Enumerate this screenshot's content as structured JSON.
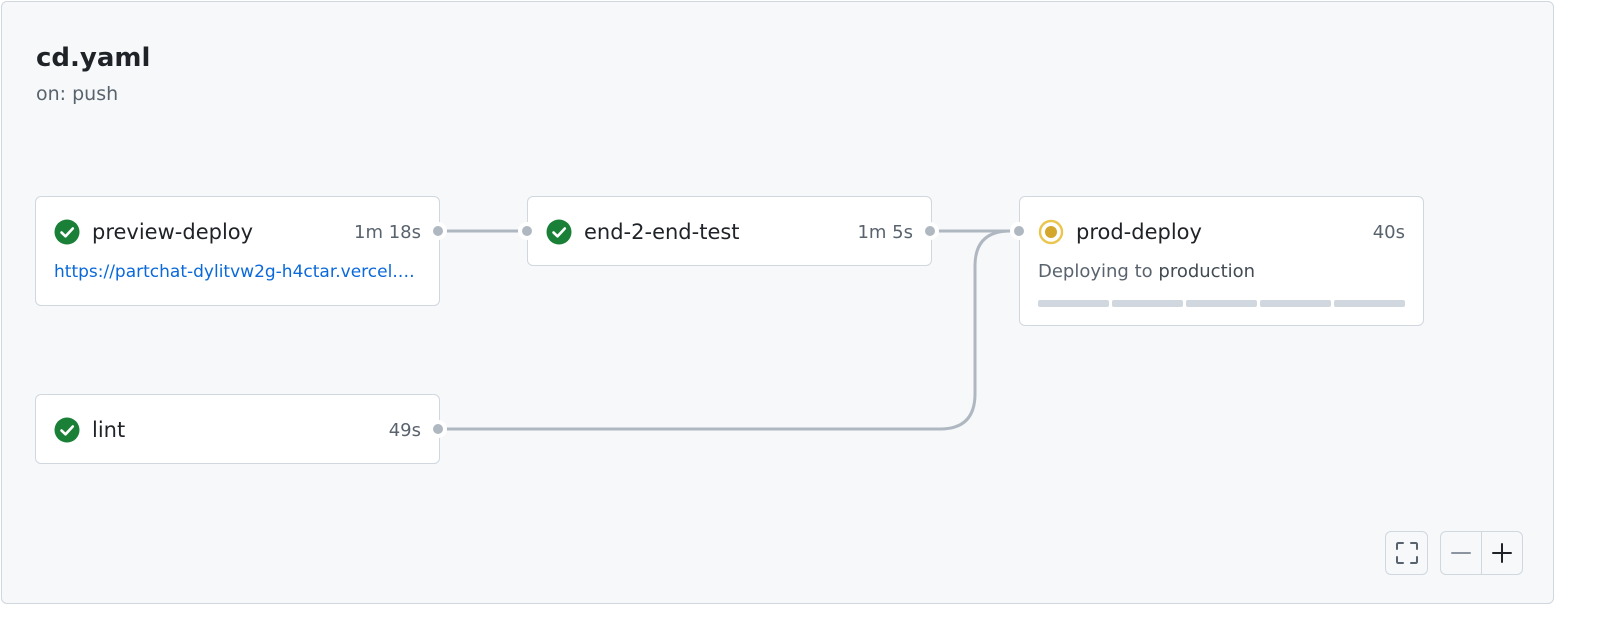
{
  "workflow": {
    "title": "cd.yaml",
    "trigger": "on: push"
  },
  "jobs": [
    {
      "name": "preview-deploy",
      "duration": "1m 18s",
      "status": "success",
      "link": "https://partchat-dylitvw2g-h4ctar.vercel.app"
    },
    {
      "name": "end-2-end-test",
      "duration": "1m 5s",
      "status": "success"
    },
    {
      "name": "prod-deploy",
      "duration": "40s",
      "status": "in_progress",
      "description_prefix": "Deploying to",
      "environment": "production",
      "progress_segments": 5
    },
    {
      "name": "lint",
      "duration": "49s",
      "status": "success"
    }
  ],
  "icons": {
    "success": "check-circle-fill-icon",
    "in_progress": "dot-fill-spinner-icon",
    "fullscreen": "screen-full-icon",
    "zoom_out": "minus-icon",
    "zoom_in": "plus-icon"
  },
  "colors": {
    "success": "#1a7f37",
    "in_progress": "#d4a72c",
    "link": "#0969da",
    "edge": "#afb8c1"
  }
}
